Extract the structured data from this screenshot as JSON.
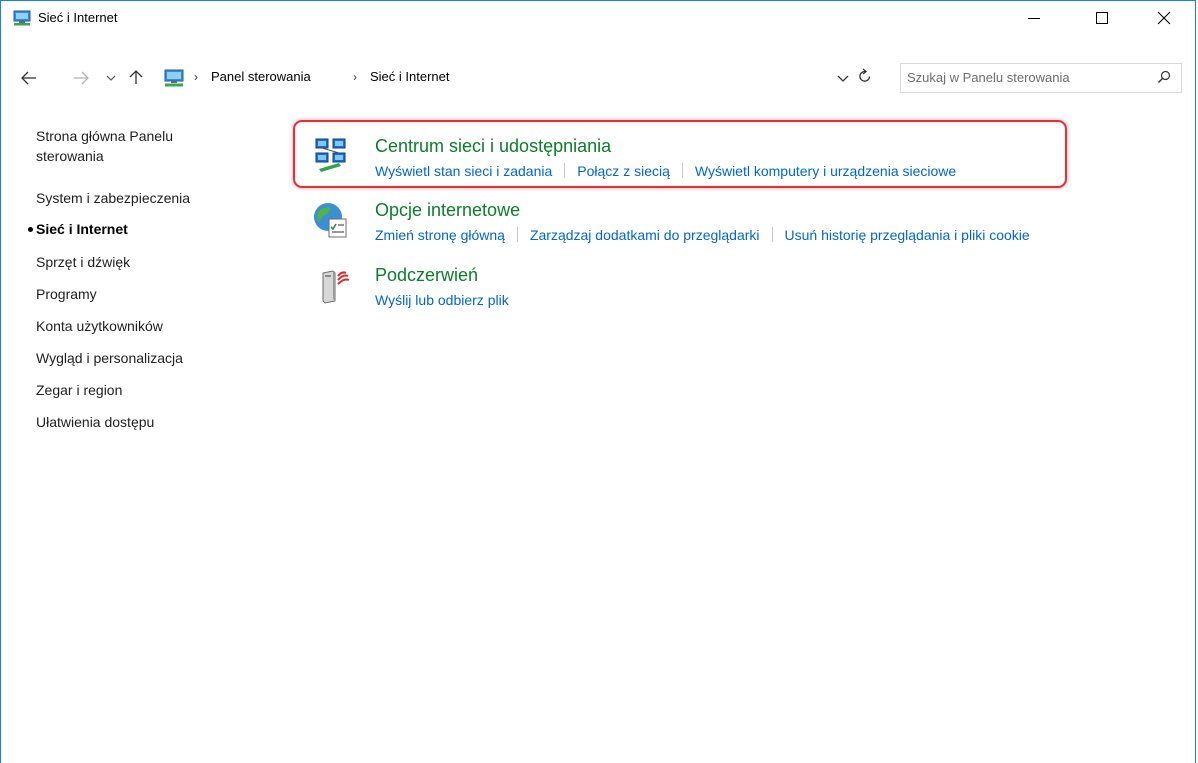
{
  "window": {
    "title": "Sieć i Internet",
    "accent_color": "#1883d7",
    "controls": {
      "minimize_icon": "minimize-icon",
      "maximize_icon": "maximize-icon",
      "close_icon": "close-icon"
    }
  },
  "addressbar": {
    "back_icon": "arrow-left-icon",
    "forward_icon": "arrow-right-icon",
    "recent_icon": "chevron-down-icon",
    "up_icon": "arrow-up-icon",
    "breadcrumbs": [
      "Panel sterowania",
      "Sieć i Internet"
    ],
    "search_placeholder": "Szukaj w Panelu sterowania"
  },
  "leftnav": {
    "items": [
      {
        "label": "Strona główna Panelu",
        "label2": "sterowania"
      },
      {
        "label": "System i zabezpieczenia"
      },
      {
        "label": "Sieć i Internet",
        "active": true
      },
      {
        "label": "Sprzęt i dźwięk"
      },
      {
        "label": "Programy"
      },
      {
        "label": "Konta użytkowników"
      },
      {
        "label": "Wygląd i personalizacja"
      },
      {
        "label": "Zegar i region"
      },
      {
        "label": "Ułatwienia dostępu"
      }
    ]
  },
  "categories": [
    {
      "title": "Centrum sieci i udostępniania",
      "icon": "network-sharing-center-icon",
      "links": [
        "Wyświetl stan sieci i zadania",
        "Połącz z siecią",
        "Wyświetl komputery i urządzenia sieciowe"
      ],
      "highlighted": true
    },
    {
      "title": "Opcje internetowe",
      "icon": "internet-options-icon",
      "links": [
        "Zmień stronę główną",
        "Zarządzaj dodatkami do przeglądarki",
        "Usuń historię przeglądania i pliki cookie"
      ]
    },
    {
      "title": "Podczerwień",
      "icon": "infrared-icon",
      "links": [
        "Wyślij lub odbierz plik"
      ]
    }
  ],
  "colors": {
    "category_title": "#0a7e28",
    "link": "#0066cc",
    "highlight": "#d9333f"
  }
}
